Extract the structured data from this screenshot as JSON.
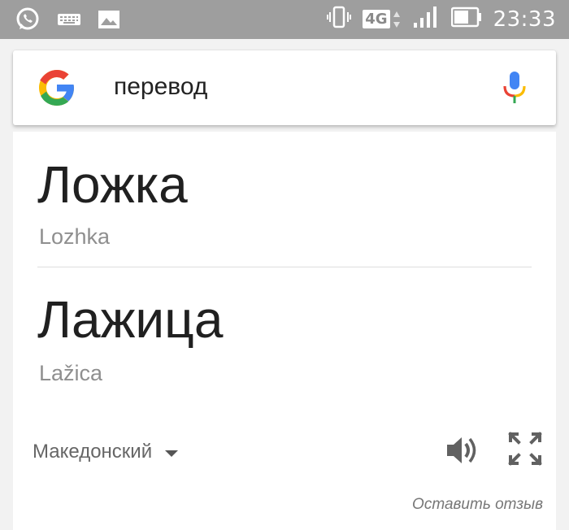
{
  "status_bar": {
    "icons_left": [
      "whatsapp-icon",
      "keyboard-icon",
      "image-icon"
    ],
    "icons_right": [
      "vibrate-icon",
      "network-4g-icon",
      "signal-icon",
      "battery-icon"
    ],
    "network": "4G",
    "time": "23:33"
  },
  "search": {
    "query": "перевод",
    "logo": "google-g-icon",
    "mic": "mic-icon"
  },
  "translation": {
    "entries": [
      {
        "word": "Ложка",
        "transliteration": "Lozhka"
      },
      {
        "word": "Лажица",
        "transliteration": "Lažica"
      }
    ],
    "language": "Македонский",
    "feedback": "Оставить отзыв"
  },
  "colors": {
    "status_bar_bg": "#9e9e9e",
    "page_bg": "#f2f2f2",
    "g_blue": "#4285F4",
    "g_red": "#EA4335",
    "g_yellow": "#FBBC05",
    "g_green": "#34A853"
  }
}
